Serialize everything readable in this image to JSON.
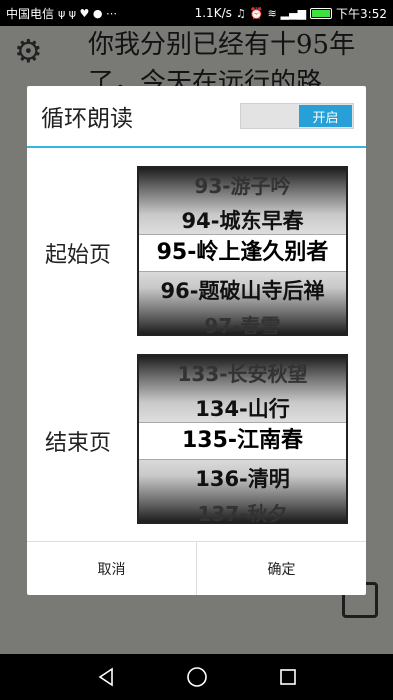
{
  "status_bar": {
    "carrier": "中国电信",
    "left_icons": "ψ ψ ♥ ● ⋯",
    "speed": "1.1K/s",
    "time": "下午3:52",
    "battery_level": 1.0
  },
  "background": {
    "text": "你我分别已经有十95年了，今天在远行的路"
  },
  "dialog": {
    "title": "循环朗读",
    "toggle_label": "开启",
    "start": {
      "label": "起始页",
      "items": [
        "93-游子吟",
        "94-城东早春",
        "95-岭上逢久别者",
        "96-题破山寺后禅",
        "97-春雪"
      ],
      "selected": "95-岭上逢久别者"
    },
    "end": {
      "label": "结束页",
      "items": [
        "133-长安秋望",
        "134-山行",
        "135-江南春",
        "136-清明",
        "137-秋夕"
      ],
      "selected": "135-江南春"
    },
    "cancel_label": "取消",
    "confirm_label": "确定"
  }
}
